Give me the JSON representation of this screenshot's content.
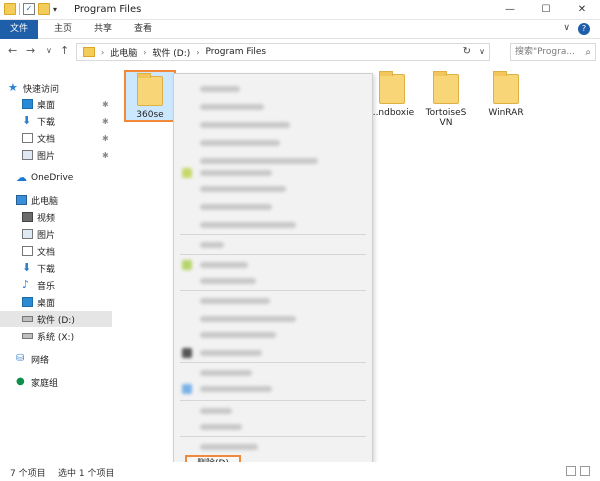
{
  "window": {
    "title": "Program Files",
    "quick_access_dropdown": "▾",
    "min_symbol": "—",
    "max_symbol": "☐",
    "close_symbol": "✕"
  },
  "ribbon": {
    "tabs": [
      {
        "label": "文件",
        "active": true
      },
      {
        "label": "主页",
        "active": false
      },
      {
        "label": "共享",
        "active": false
      },
      {
        "label": "查看",
        "active": false
      }
    ],
    "expand_symbol": "∨",
    "help_symbol": "?"
  },
  "address": {
    "back": "←",
    "forward": "→",
    "history": "∨",
    "up": "↑",
    "crumbs": [
      "此电脑",
      "软件 (D:)",
      "Program Files"
    ],
    "crumb_separator": "›",
    "dropdown": "∨",
    "refresh": "↻",
    "search_placeholder": "搜索\"Progra...",
    "search_icon": "⌕"
  },
  "nav": {
    "quick_access": "快速访问",
    "pinned": [
      {
        "label": "桌面",
        "icon": "desktop-icon"
      },
      {
        "label": "下载",
        "icon": "download-icon"
      },
      {
        "label": "文档",
        "icon": "documents-icon"
      },
      {
        "label": "图片",
        "icon": "pictures-icon"
      }
    ],
    "pin_symbol": "✱",
    "onedrive": "OneDrive",
    "this_pc": "此电脑",
    "pc_items": [
      {
        "label": "视频"
      },
      {
        "label": "图片"
      },
      {
        "label": "文档"
      },
      {
        "label": "下载"
      },
      {
        "label": "音乐"
      },
      {
        "label": "桌面"
      },
      {
        "label": "软件 (D:)",
        "selected": true
      },
      {
        "label": "系统 (X:)"
      }
    ],
    "network": "网络",
    "homegroup": "家庭组"
  },
  "files": [
    {
      "name": "360se",
      "selected": true
    },
    {
      "name": "...ndboxie",
      "selected": false
    },
    {
      "name": "TortoiseSVN",
      "selected": false
    },
    {
      "name": "WinRAR",
      "selected": false
    }
  ],
  "context_menu": {
    "delete_label": "删除(D)"
  },
  "status": {
    "item_count": "7 个项目",
    "selected_count": "选中 1 个项目"
  },
  "colors": {
    "accent": "#1f5ea8",
    "highlight": "#f08a3a",
    "selection": "#cce8ff"
  }
}
